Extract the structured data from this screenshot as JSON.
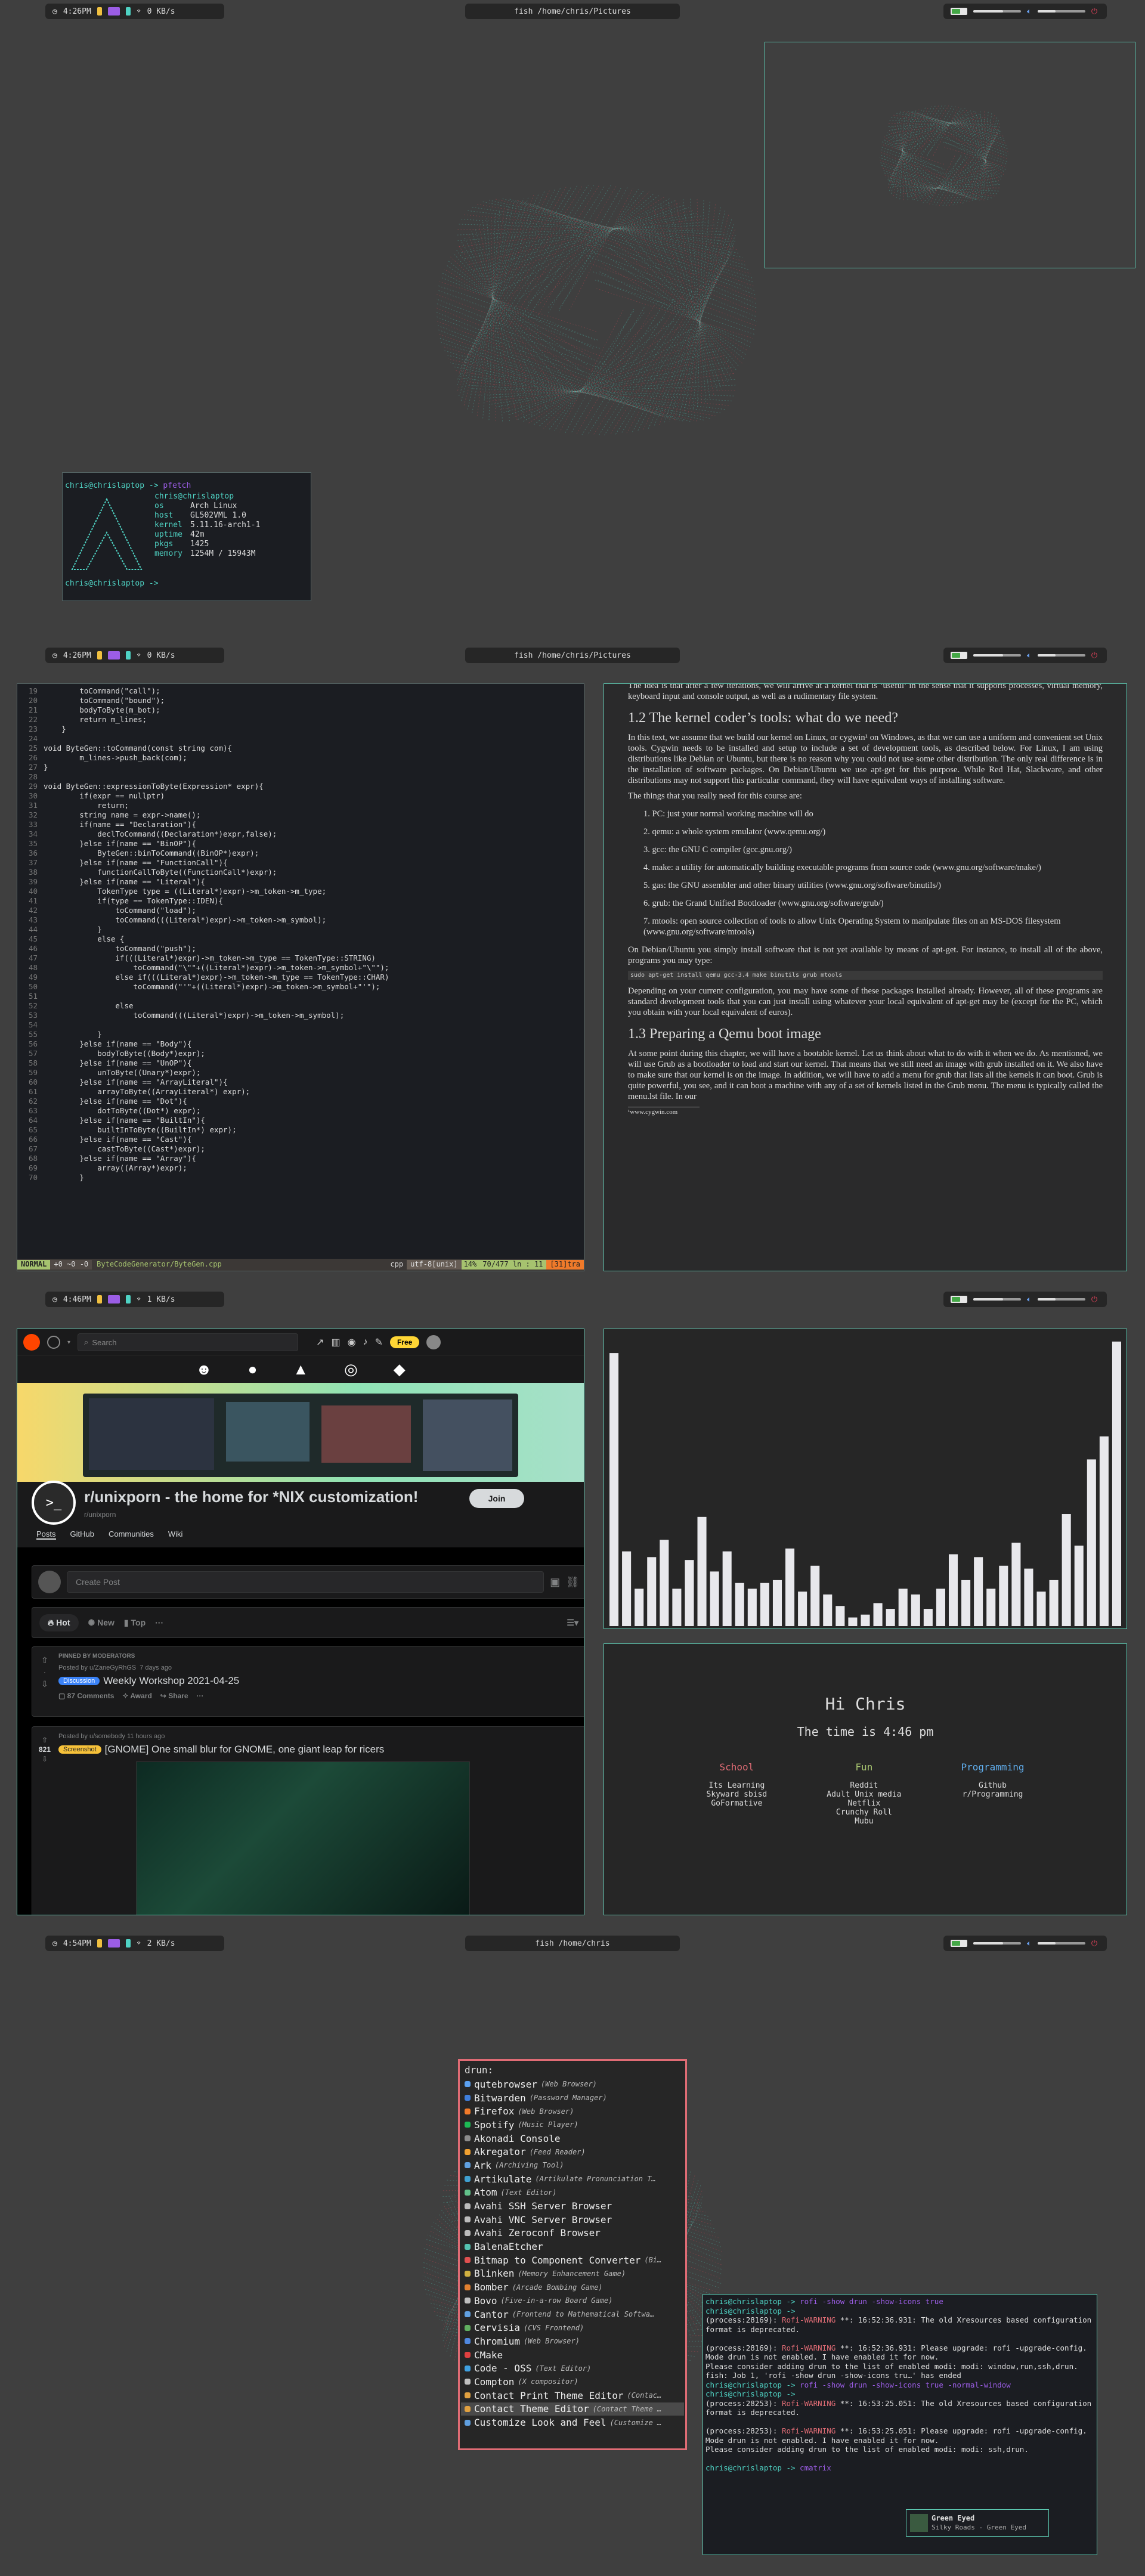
{
  "colors": {
    "bg": "#3f3f3f",
    "bar_pill": "#262626",
    "accent_teal": "#4fd3c4",
    "accent_red": "#e24a5a",
    "workspace_active": "#9b5de5",
    "battery_green": "#44a847",
    "power_red": "#e2425a",
    "terminal_border": "#5bc8b0",
    "rofi_border": "#e06c75"
  },
  "panels": [
    {
      "time": "4:26PM",
      "workspace": "1",
      "netspeed": "0 KB/s",
      "title": "fish /home/chris/Pictures"
    },
    {
      "time": "4:26PM",
      "workspace": "2",
      "netspeed": "0 KB/s",
      "title": "fish /home/chris/Pictures"
    },
    {
      "time": "4:46PM",
      "workspace": "3",
      "netspeed": "1 KB/s",
      "title": ""
    },
    {
      "time": "4:54PM",
      "workspace": "4",
      "netspeed": "2 KB/s",
      "title": "fish /home/chris"
    }
  ],
  "neofetch": {
    "prompt1": "chris@chrislaptop -> ",
    "cmd1": "pfetch",
    "prompt2": "chris@chrislaptop -> ",
    "user": "chris@chrislaptop",
    "rows": [
      {
        "k": "os",
        "v": "Arch Linux"
      },
      {
        "k": "host",
        "v": "GL502VML 1.0"
      },
      {
        "k": "kernel",
        "v": "5.11.16-arch1-1"
      },
      {
        "k": "uptime",
        "v": "42m"
      },
      {
        "k": "pkgs",
        "v": "1425"
      },
      {
        "k": "memory",
        "v": "1254M / 15943M"
      }
    ]
  },
  "editor": {
    "lines": [
      {
        "n": "19",
        "t": "        toCommand(\"call\");"
      },
      {
        "n": "20",
        "t": "        toCommand(\"bound\");"
      },
      {
        "n": "21",
        "t": "        bodyToByte(m_bot);"
      },
      {
        "n": "22",
        "t": "        return m_lines;"
      },
      {
        "n": "23",
        "t": "    }"
      },
      {
        "n": "24",
        "t": ""
      },
      {
        "n": "25",
        "t": "void ByteGen::toCommand(const string com){"
      },
      {
        "n": "26",
        "t": "        m_lines->push_back(com);"
      },
      {
        "n": "27",
        "t": "}"
      },
      {
        "n": "28",
        "t": ""
      },
      {
        "n": "29",
        "t": "void ByteGen::expressionToByte(Expression* expr){"
      },
      {
        "n": "30",
        "t": "        if(expr == nullptr)"
      },
      {
        "n": "31",
        "t": "            return;"
      },
      {
        "n": "32",
        "t": "        string name = expr->name();"
      },
      {
        "n": "33",
        "t": "        if(name == \"Declaration\"){"
      },
      {
        "n": "34",
        "t": "            declToCommand((Declaration*)expr,false);"
      },
      {
        "n": "35",
        "t": "        }else if(name == \"BinOP\"){"
      },
      {
        "n": "36",
        "t": "            ByteGen::binToCommand((BinOP*)expr);"
      },
      {
        "n": "37",
        "t": "        }else if(name == \"FunctionCall\"){"
      },
      {
        "n": "38",
        "t": "            functionCallToByte((FunctionCall*)expr);"
      },
      {
        "n": "39",
        "t": "        }else if(name == \"Literal\"){"
      },
      {
        "n": "40",
        "t": "            TokenType type = ((Literal*)expr)->m_token->m_type;"
      },
      {
        "n": "41",
        "t": "            if(type == TokenType::IDEN){"
      },
      {
        "n": "42",
        "t": "                toCommand(\"load\");"
      },
      {
        "n": "43",
        "t": "                toCommand(((Literal*)expr)->m_token->m_symbol);"
      },
      {
        "n": "44",
        "t": "            }"
      },
      {
        "n": "45",
        "t": "            else {"
      },
      {
        "n": "46",
        "t": "                toCommand(\"push\");"
      },
      {
        "n": "47",
        "t": "                if(((Literal*)expr)->m_token->m_type == TokenType::STRING)"
      },
      {
        "n": "48",
        "t": "                    toCommand(\"\\\"\"+((Literal*)expr)->m_token->m_symbol+\"\\\"\");"
      },
      {
        "n": "49",
        "t": "                else if(((Literal*)expr)->m_token->m_type == TokenType::CHAR)"
      },
      {
        "n": "50",
        "t": "                    toCommand(\"'\"+((Literal*)expr)->m_token->m_symbol+\"'\");"
      },
      {
        "n": "51",
        "t": ""
      },
      {
        "n": "52",
        "t": "                else"
      },
      {
        "n": "53",
        "t": "                    toCommand(((Literal*)expr)->m_token->m_symbol);"
      },
      {
        "n": "54",
        "t": ""
      },
      {
        "n": "55",
        "t": "            }"
      },
      {
        "n": "56",
        "t": "        }else if(name == \"Body\"){"
      },
      {
        "n": "57",
        "t": "            bodyToByte((Body*)expr);"
      },
      {
        "n": "58",
        "t": "        }else if(name == \"UnOP\"){"
      },
      {
        "n": "59",
        "t": "            unToByte((Unary*)expr);"
      },
      {
        "n": "60",
        "t": "        }else if(name == \"ArrayLiteral\"){"
      },
      {
        "n": "61",
        "t": "            arrayToByte((ArrayLiteral*) expr);"
      },
      {
        "n": "62",
        "t": "        }else if(name == \"Dot\"){"
      },
      {
        "n": "63",
        "t": "            dotToByte((Dot*) expr);"
      },
      {
        "n": "64",
        "t": "        }else if(name == \"BuiltIn\"){"
      },
      {
        "n": "65",
        "t": "            builtInToByte((BuiltIn*) expr);"
      },
      {
        "n": "66",
        "t": "        }else if(name == \"Cast\"){"
      },
      {
        "n": "67",
        "t": "            castToByte((Cast*)expr);"
      },
      {
        "n": "68",
        "t": "        }else if(name == \"Array\"){"
      },
      {
        "n": "69",
        "t": "            array((Array*)expr);"
      },
      {
        "n": "70",
        "t": "        }"
      }
    ],
    "status_mode": "NORMAL",
    "status_git": "+0 ~0 -0",
    "status_file": "ByteCodeGenerator/ByteGen.cpp",
    "status_ft": "cpp",
    "status_enc": "utf-8[unix]",
    "status_pct": "14%",
    "status_pos": "70/477 ln : 11",
    "status_err": "[31]tra"
  },
  "pdf": {
    "intro": "The idea is that after a few iterations, we will arrive at a kernel that is ‘useful’ in the sense that it supports processes, virtual memory, keyboard input and console output, as well as a rudimentary file system.",
    "h1": "1.2    The kernel coder’s tools:  what do we need?",
    "p1": "In this text, we assume that we build our kernel on Linux, or cygwin¹ on Windows, as that we can use a uniform and convenient set Unix tools. Cygwin needs to be installed and setup to include a set of development tools, as described below. For Linux, I am using distributions like Debian or Ubuntu, but there is no reason why you could not use some other distribution. The only real difference is in the installation of software packages. On Debian/Ubuntu we use apt-get for this purpose. While Red Hat, Slackware, and other distributions may not support this particular command, they will have equivalent ways of installing software.",
    "p2": "The things that you really need for this course are:",
    "items": [
      "1.  PC: just your normal working machine will do",
      "2.  qemu: a whole system emulator (www.qemu.org/)",
      "3.  gcc: the GNU C compiler (gcc.gnu.org/)",
      "4.  make: a utility for automatically building executable programs from source code (www.gnu.org/software/make/)",
      "5.  gas: the GNU assembler and other binary utilities (www.gnu.org/software/binutils/)",
      "6.  grub: the Grand Unified Bootloader (www.gnu.org/software/grub/)",
      "7.  mtools: open source collection of tools to allow Unix Operating System to manipulate files on an MS-DOS filesystem (www.gnu.org/software/mtools)"
    ],
    "p3": "On Debian/Ubuntu you simply install software that is not yet available by means of apt-get. For instance, to install all of the above, programs you may type:",
    "cmd": "sudo apt-get install qemu gcc-3.4 make binutils grub mtools",
    "p4": "Depending on your current configuration, you may have some of these packages installed already. However, all of these programs are standard development tools that you can just install using whatever your local equivalent of apt-get may be (except for the PC, which you obtain with your local equivalent of euros).",
    "h2": "1.3    Preparing a Qemu boot image",
    "p5": "At some point during this chapter, we will have a bootable kernel. Let us think about what to do with it when we do. As mentioned, we will use Grub as a bootloader to load and start our kernel. That means that we still need an image with grub installed on it. We also have to make sure that our kernel is on the image. In addition, we will have to add a menu for grub that lists all the kernels it can boot. Grub is quite powerful, you see, and it can boot a machine with any of a set of kernels listed in the Grub menu. The menu is typically called the menu.lst file. In our",
    "foot": "¹www.cygwin.com"
  },
  "reddit": {
    "search_placeholder": "Search",
    "free_label": "Free",
    "title": "r/unixporn - the home for *NIX customization!",
    "sub": "r/unixporn",
    "join": "Join",
    "tabs": [
      "Posts",
      "GitHub",
      "Communities",
      "Wiki"
    ],
    "create_post": "Create Post",
    "sort": [
      "Hot",
      "New",
      "Top",
      "···"
    ],
    "pinned_label": "PINNED BY MODERATORS",
    "post1_meta": "Posted by u/ZaneGyRhGS",
    "post1_flair": "Discussion",
    "post1_title": "Weekly Workshop 2021-04-25",
    "post1_comments": "87 Comments",
    "post1_award": "Award",
    "post1_share": "Share",
    "post1_more": "···",
    "post1_time": "7 days ago",
    "post2_meta": "Posted by u/somebody 11 hours ago",
    "post2_votes": "821",
    "post2_flair": "Screenshot",
    "post2_title": "[GNOME] One small blur for GNOME, one giant leap for ricers"
  },
  "visualizer": {
    "bars": [
      95,
      26,
      13,
      24,
      30,
      13,
      23,
      38,
      19,
      26,
      15,
      13,
      15,
      16,
      27,
      12,
      21,
      11,
      7,
      3,
      4,
      8,
      6,
      13,
      11,
      6,
      13,
      25,
      16,
      24,
      13,
      21,
      29,
      20,
      12,
      16,
      39,
      28,
      58,
      66,
      99
    ]
  },
  "startpage": {
    "greeting": "Hi Chris",
    "time": "The time is 4:46 pm",
    "cols": [
      {
        "h": "School",
        "color": "#e06c75",
        "links": [
          "Its Learning",
          "Skyward sbisd",
          "GoFormative"
        ]
      },
      {
        "h": "Fun",
        "color": "#a6c36f",
        "links": [
          "Reddit",
          "Adult Unix media",
          "Netflix",
          "Crunchy Roll",
          "Mubu"
        ]
      },
      {
        "h": "Programming",
        "color": "#61afef",
        "links": [
          "Github",
          "r/Programming"
        ]
      }
    ]
  },
  "rofi": {
    "prompt": "drun:",
    "items": [
      {
        "name": "qutebrowser",
        "desc": "(Web Browser)",
        "c": "#5ba0f0"
      },
      {
        "name": "Bitwarden",
        "desc": "(Password Manager)",
        "c": "#3f7fdd"
      },
      {
        "name": "Firefox",
        "desc": "(Web Browser)",
        "c": "#f07a2a"
      },
      {
        "name": "Spotify",
        "desc": "(Music Player)",
        "c": "#1db954"
      },
      {
        "name": "Akonadi Console",
        "desc": "",
        "c": "#8c8c8c"
      },
      {
        "name": "Akregator",
        "desc": "(Feed Reader)",
        "c": "#f0a030"
      },
      {
        "name": "Ark",
        "desc": "(Archiving Tool)",
        "c": "#60a0e0"
      },
      {
        "name": "Artikulate",
        "desc": "(Artikulate Pronunciation T…",
        "c": "#3fa0d0"
      },
      {
        "name": "Atom",
        "desc": "(Text Editor)",
        "c": "#62c28a"
      },
      {
        "name": "Avahi SSH Server Browser",
        "desc": "",
        "c": "#bbbbbb"
      },
      {
        "name": "Avahi VNC Server Browser",
        "desc": "",
        "c": "#bbbbbb"
      },
      {
        "name": "Avahi Zeroconf Browser",
        "desc": "",
        "c": "#bbbbbb"
      },
      {
        "name": "BalenaEtcher",
        "desc": "",
        "c": "#54c2b0"
      },
      {
        "name": "Bitmap to Component Converter",
        "desc": "(Bi…",
        "c": "#e05050"
      },
      {
        "name": "Blinken",
        "desc": "(Memory Enhancement Game)",
        "c": "#d0b040"
      },
      {
        "name": "Bomber",
        "desc": "(Arcade Bombing Game)",
        "c": "#e08030"
      },
      {
        "name": "Bovo",
        "desc": "(Five-in-a-row Board Game)",
        "c": "#c0c0c0"
      },
      {
        "name": "Cantor",
        "desc": "(Frontend to Mathematical Softwa…",
        "c": "#60a0e0"
      },
      {
        "name": "Cervisia",
        "desc": "(CVS Frontend)",
        "c": "#60b060"
      },
      {
        "name": "Chromium",
        "desc": "(Web Browser)",
        "c": "#4f88e0"
      },
      {
        "name": "CMake",
        "desc": "",
        "c": "#e04040"
      },
      {
        "name": "Code - OSS",
        "desc": "(Text Editor)",
        "c": "#3fa0e0"
      },
      {
        "name": "Compton",
        "desc": "(X compositor)",
        "c": "#c0c0c0"
      },
      {
        "name": "Contact Print Theme Editor",
        "desc": "(Contac…",
        "c": "#e0a040"
      },
      {
        "name": "Contact Theme Editor",
        "desc": "(Contact Theme …",
        "c": "#e0a040"
      },
      {
        "name": "Customize Look and Feel",
        "desc": "(Customize …",
        "c": "#60a0e0"
      }
    ],
    "selected": 24
  },
  "term4": {
    "lines": [
      {
        "t": "chris@chrislaptop -> rofi -show drun -show-icons true",
        "c": "#ddd"
      },
      {
        "t": "chris@chrislaptop ->",
        "c": "#ddd"
      },
      {
        "t": "(process:28169): Rofi-WARNING **: 16:52:36.931: The old Xresources based configuration format is deprecated.",
        "c": "#ddd"
      },
      {
        "t": "",
        "c": "#ddd"
      },
      {
        "t": "(process:28169): Rofi-WARNING **: 16:52:36.931: Please upgrade: rofi -upgrade-config.",
        "c": "#ddd"
      },
      {
        "t": "Mode drun is not enabled. I have enabled it for now.",
        "c": "#ddd"
      },
      {
        "t": "Please consider adding drun to the list of enabled modi: modi: window,run,ssh,drun.",
        "c": "#ddd"
      },
      {
        "t": "fish: Job 1, 'rofi -show drun -show-icons tru…' has ended",
        "c": "#ddd"
      },
      {
        "t": "chris@chrislaptop -> rofi -show drun -show-icons true -normal-window",
        "c": "#ddd"
      },
      {
        "t": "chris@chrislaptop ->",
        "c": "#ddd"
      },
      {
        "t": "(process:28253): Rofi-WARNING **: 16:53:25.051: The old Xresources based configuration format is deprecated.",
        "c": "#ddd"
      },
      {
        "t": "",
        "c": "#ddd"
      },
      {
        "t": "(process:28253): Rofi-WARNING **: 16:53:25.051: Please upgrade: rofi -upgrade-config.",
        "c": "#ddd"
      },
      {
        "t": "Mode drun is not enabled. I have enabled it for now.",
        "c": "#ddd"
      },
      {
        "t": "Please consider adding drun to the list of enabled modi: modi: ssh,drun.",
        "c": "#ddd"
      },
      {
        "t": "",
        "c": "#ddd"
      },
      {
        "t": "chris@chrislaptop -> cmatrix",
        "c": "#ddd"
      }
    ],
    "notif_title": "Green Eyed",
    "notif_body": "Silky Roads - Green Eyed"
  }
}
